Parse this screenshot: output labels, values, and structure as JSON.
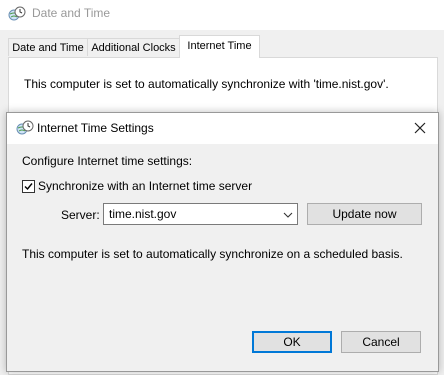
{
  "background_window": {
    "title": "Date and Time",
    "tabs": [
      {
        "label": "Date and Time",
        "selected": false
      },
      {
        "label": "Additional Clocks",
        "selected": false
      },
      {
        "label": "Internet Time",
        "selected": true
      }
    ],
    "status_text": "This computer is set to automatically synchronize with 'time.nist.gov'."
  },
  "dialog": {
    "title": "Internet Time Settings",
    "close_icon": "close-icon",
    "group_label": "Configure Internet time settings:",
    "sync_checkbox": {
      "label": "Synchronize with an Internet time server",
      "checked": true
    },
    "server_label": "Server:",
    "server_value": "time.nist.gov",
    "update_button": "Update now",
    "status_text": "This computer is set to automatically synchronize on a scheduled basis.",
    "ok_button": "OK",
    "cancel_button": "Cancel"
  },
  "colors": {
    "accent": "#0078d7",
    "window_bg": "#f0f0f0",
    "button_bg": "#e1e1e1"
  }
}
